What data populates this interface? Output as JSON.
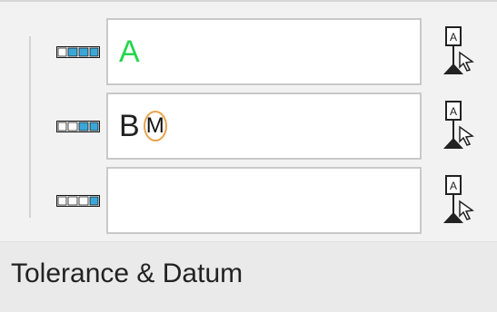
{
  "rows": [
    {
      "value": "A"
    },
    {
      "value": "B",
      "modifier": "M"
    },
    {
      "value": ""
    }
  ],
  "footer": {
    "label": "Tolerance & Datum"
  },
  "icons": {
    "row_indicator": "frame-segments-icon",
    "datum_picker": "datum-pick-icon"
  },
  "colors": {
    "datum_a_text": "#22d64d",
    "modifier_circle": "#e8a24a",
    "segment_fill": "#3aa7d8"
  }
}
